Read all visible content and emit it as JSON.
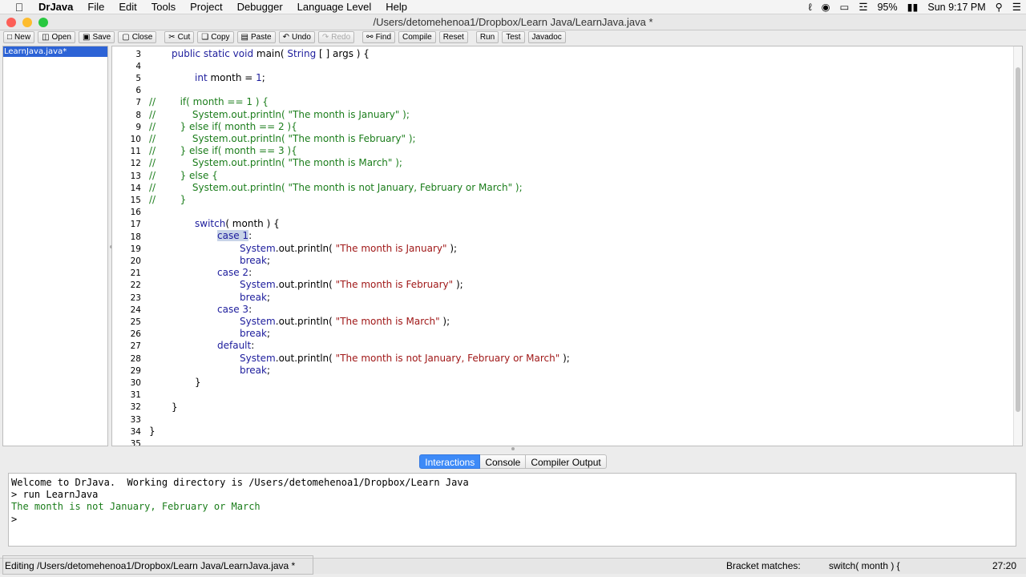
{
  "menubar": {
    "apple": "",
    "app_name": "DrJava",
    "items": [
      "File",
      "Edit",
      "Tools",
      "Project",
      "Debugger",
      "Language Level",
      "Help"
    ],
    "battery": "95%",
    "clock": "Sun 9:17 PM"
  },
  "window": {
    "title": "/Users/detomehenoa1/Dropbox/Learn Java/LearnJava.java *"
  },
  "toolbar": {
    "new": "New",
    "open": "Open",
    "save": "Save",
    "close": "Close",
    "cut": "Cut",
    "copy": "Copy",
    "paste": "Paste",
    "undo": "Undo",
    "redo": "Redo",
    "find": "Find",
    "compile": "Compile",
    "reset": "Reset",
    "run": "Run",
    "test": "Test",
    "javadoc": "Javadoc"
  },
  "files": [
    "LearnJava.java*"
  ],
  "editor": {
    "line_numbers": [
      "3",
      "4",
      "5",
      "6",
      "7",
      "8",
      "9",
      "10",
      "11",
      "12",
      "13",
      "14",
      "15",
      "16",
      "17",
      "18",
      "19",
      "20",
      "21",
      "22",
      "23",
      "24",
      "25",
      "26",
      "27",
      "28",
      "29",
      "30",
      "31",
      "32",
      "33",
      "34",
      "35"
    ],
    "l3": {
      "kw1": "public static void",
      "txt1": " main( ",
      "kw2": "String",
      "txt2": " [ ] args ) {"
    },
    "l5": {
      "kw1": "int",
      "txt1": " month = ",
      "num1": "1",
      "txt2": ";"
    },
    "l7": "//        if( month == 1 ) {",
    "l8": "//            System.out.println( \"The month is January\" );",
    "l9": "//        } else if( month == 2 ){",
    "l10": "//            System.out.println( \"The month is February\" );",
    "l11": "//        } else if( month == 3 ){",
    "l12": "//            System.out.println( \"The month is March\" );",
    "l13": "//        } else {",
    "l14": "//            System.out.println( \"The month is not January, February or March\" );",
    "l15": "//        }",
    "l17": {
      "kw1": "switch",
      "txt1": "( month ) {"
    },
    "l18": {
      "kw1": "case",
      "num1": "1",
      "txt1": ":"
    },
    "l19": {
      "kw1": "System",
      "txt1": ".out.println( ",
      "str1": "\"The month is January\"",
      "txt2": " );"
    },
    "l20": {
      "kw1": "break",
      "txt1": ";"
    },
    "l21": {
      "kw1": "case",
      "num1": "2",
      "txt1": ":"
    },
    "l22": {
      "kw1": "System",
      "txt1": ".out.println( ",
      "str1": "\"The month is February\"",
      "txt2": " );"
    },
    "l23": {
      "kw1": "break",
      "txt1": ";"
    },
    "l24": {
      "kw1": "case",
      "num1": "3",
      "txt1": ":"
    },
    "l25": {
      "kw1": "System",
      "txt1": ".out.println( ",
      "str1": "\"The month is March\"",
      "txt2": " );"
    },
    "l26": {
      "kw1": "break",
      "txt1": ";"
    },
    "l27": {
      "kw1": "default",
      "txt1": ":"
    },
    "l28": {
      "kw1": "System",
      "txt1": ".out.println( ",
      "str1": "\"The month is not January, February or March\"",
      "txt2": " );"
    },
    "l29": {
      "kw1": "break",
      "txt1": ";"
    },
    "l30": "}",
    "l32": "}",
    "l34": "}"
  },
  "bottom_tabs": [
    "Interactions",
    "Console",
    "Compiler Output"
  ],
  "interactions": [
    "Welcome to DrJava.  Working directory is /Users/detomehenoa1/Dropbox/Learn Java",
    "> run LearnJava",
    "The month is not January, February or March",
    ">"
  ],
  "status": {
    "editing": "Editing /Users/detomehenoa1/Dropbox/Learn Java/LearnJava.java *",
    "bracket_label": "Bracket matches:",
    "bracket_value": "switch( month ) {",
    "position": "27:20"
  },
  "colors": {
    "keyword": "#1c1c9c",
    "string": "#a01818",
    "comment": "#1b7d1b",
    "selection": "#2c63d6",
    "active_tab": "#3d8af7"
  }
}
